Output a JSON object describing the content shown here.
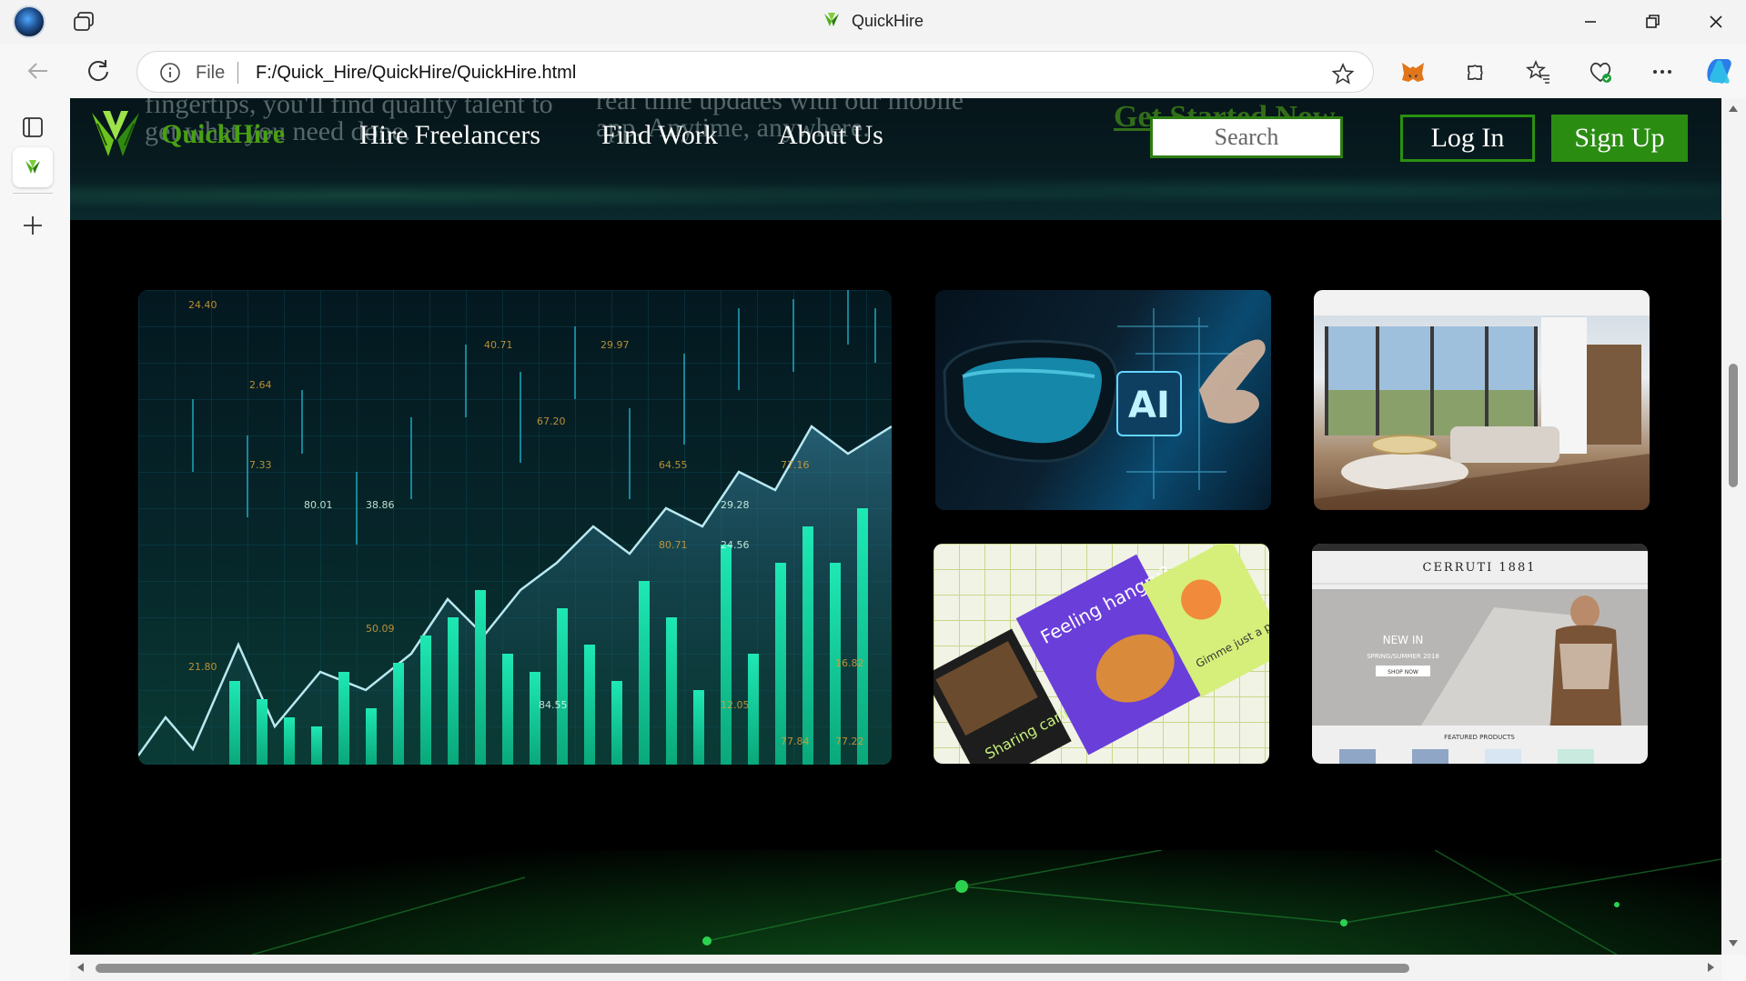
{
  "browser": {
    "tab_title": "QuickHire",
    "address": {
      "scheme_label": "File",
      "url": "F:/Quick_Hire/QuickHire/QuickHire.html"
    }
  },
  "site": {
    "brand_name": "QuickHire",
    "nav": [
      "Hire Freelancers",
      "Find Work",
      "About Us"
    ],
    "search_placeholder": "Search",
    "login_label": "Log In",
    "signup_label": "Sign Up",
    "ghost": {
      "left_line1": "fingertips, you'll find quality talent to",
      "left_line2": "get what you need done.",
      "right_line1": "real time updates with our mobile",
      "right_line2": "app. Anytime, anywhere.",
      "cta": "Get Started Now"
    },
    "colors": {
      "brand_green": "#49a013",
      "button_green": "#2a8d12",
      "header_dark": "#06151a"
    }
  },
  "gallery": [
    {
      "name": "stock-chart",
      "texts": [
        "24.40",
        "40.71",
        "29.97",
        "2.64",
        "7.33",
        "80.01",
        "38.86",
        "67.20",
        "64.55",
        "29.28",
        "24.56",
        "77.16",
        "80.71",
        "50.09",
        "21.80",
        "84.55",
        "12.05",
        "77.84",
        "77.22",
        "16.82"
      ]
    },
    {
      "name": "ai-glasses",
      "texts": [
        "AI"
      ]
    },
    {
      "name": "interior-room",
      "texts": []
    },
    {
      "name": "flyers",
      "texts": [
        "Feeling hangry?",
        "Sharing caring",
        "Gimme just a pinch"
      ]
    },
    {
      "name": "cerruti-site",
      "texts": [
        "CERRUTI 1881",
        "NEW IN",
        "SPRING/SUMMER 2018",
        "SHOP NOW",
        "FEATURED PRODUCTS"
      ]
    }
  ]
}
